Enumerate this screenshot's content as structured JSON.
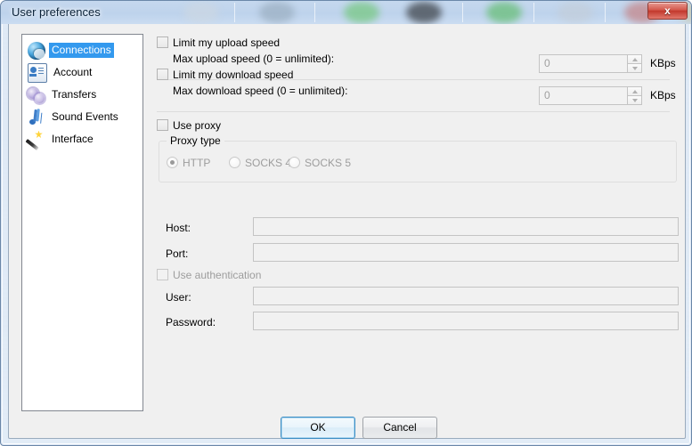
{
  "window": {
    "title": "User preferences",
    "close_label": "x",
    "close_icon": "close-icon"
  },
  "sidebar": {
    "items": [
      {
        "label": "Connections",
        "icon": "globe-icon",
        "selected": true
      },
      {
        "label": "Account",
        "icon": "id-card-icon",
        "selected": false
      },
      {
        "label": "Transfers",
        "icon": "gears-icon",
        "selected": false
      },
      {
        "label": "Sound Events",
        "icon": "music-note-icon",
        "selected": false
      },
      {
        "label": "Interface",
        "icon": "magic-wand-icon",
        "selected": false
      }
    ]
  },
  "connections": {
    "upload": {
      "checkbox_label": "Limit my upload speed",
      "checked": false,
      "sub_label": "Max upload speed (0 = unlimited):",
      "value": "0",
      "unit": "KBps",
      "enabled": false
    },
    "download": {
      "checkbox_label": "Limit my download speed",
      "checked": false,
      "sub_label": "Max download speed (0 = unlimited):",
      "value": "0",
      "unit": "KBps",
      "enabled": false
    },
    "proxy": {
      "checkbox_label": "Use proxy",
      "checked": false,
      "group_title": "Proxy type",
      "types": [
        {
          "label": "HTTP",
          "checked": true
        },
        {
          "label": "SOCKS 4",
          "checked": false
        },
        {
          "label": "SOCKS 5",
          "checked": false
        }
      ],
      "host_label": "Host:",
      "host_value": "",
      "port_label": "Port:",
      "port_value": "",
      "auth_checkbox_label": "Use authentication",
      "auth_checked": false,
      "user_label": "User:",
      "user_value": "",
      "password_label": "Password:",
      "password_value": ""
    }
  },
  "footer": {
    "ok_label": "OK",
    "cancel_label": "Cancel"
  },
  "colors": {
    "selection_blue": "#3399ee",
    "dialog_background": "#f0f0f0",
    "close_red": "#c2392d",
    "glass_blue": "#bed3ec"
  }
}
